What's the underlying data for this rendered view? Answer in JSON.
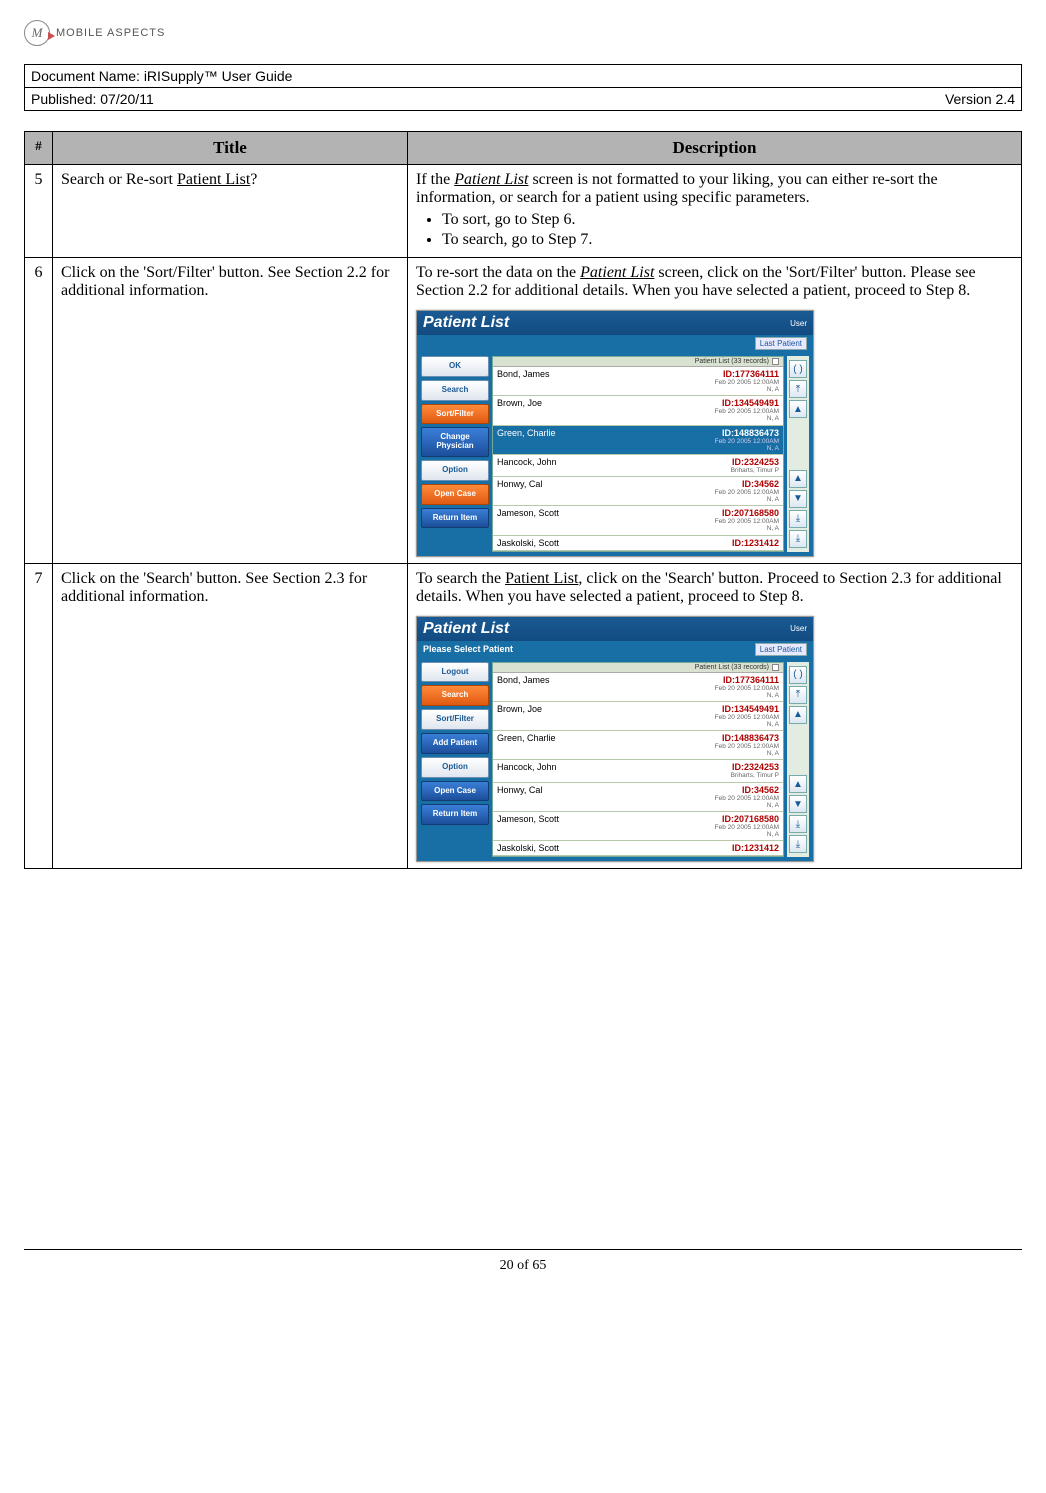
{
  "logo": {
    "text": "MOBILE ASPECTS"
  },
  "header": {
    "doc_label": "Document Name:  iRISupply™ User Guide",
    "pub_label": "Published:  07/20/11",
    "version": "Version 2.4"
  },
  "table": {
    "headers": {
      "num": "#",
      "title": "Title",
      "desc": "Description"
    },
    "rows": [
      {
        "num": "5",
        "title_pre": "Search or Re-sort ",
        "title_u": "Patient List",
        "title_post": "?",
        "desc_pre": "If the ",
        "desc_u": "Patient List",
        "desc_post": " screen is not formatted to your liking, you can either re-sort the information, or search for a patient using specific parameters.",
        "bullets": [
          "To sort, go to Step 6.",
          "To search, go to Step 7."
        ]
      },
      {
        "num": "6",
        "title": "Click on the 'Sort/Filter' button.  See Section 2.2 for additional information.",
        "desc_pre": "To re-sort the data on the ",
        "desc_u": "Patient List",
        "desc_post": " screen, click on the 'Sort/Filter' button.  Please see Section 2.2 for additional details.  When you have selected a patient, proceed to Step 8."
      },
      {
        "num": "7",
        "title": "Click on the 'Search' button.  See Section 2.3 for additional information.",
        "desc_pre": "To search the ",
        "desc_u": "Patient List",
        "desc_post": ", click on the 'Search' button.  Proceed to Section 2.3 for additional details.  When you have selected a patient, proceed to Step 8."
      }
    ]
  },
  "mini6": {
    "title": "Patient List",
    "user": "User",
    "sub": "",
    "last": "Last Patient",
    "list_header": "Patient List (33 records)",
    "sidebar": [
      {
        "label": "OK",
        "style": "default"
      },
      {
        "label": "Search",
        "style": "default"
      },
      {
        "label": "Sort/Filter",
        "style": "active-orange"
      },
      {
        "label": "Change Physician",
        "style": "active-blue"
      },
      {
        "label": "Option",
        "style": "default"
      },
      {
        "label": "Open Case",
        "style": "active-orange"
      },
      {
        "label": "Return Item",
        "style": "active-blue"
      }
    ],
    "rows": [
      {
        "name": "Bond, James",
        "id": "ID:177364111",
        "meta": "Feb 20 2005 12:00AM\nN, A"
      },
      {
        "name": "Brown, Joe",
        "id": "ID:134549491",
        "meta": "Feb 20 2005 12:00AM\nN, A"
      },
      {
        "name": "Green, Charlie",
        "id": "ID:148836473",
        "meta": "Feb 20 2005 12:00AM\nN, A",
        "sel": true
      },
      {
        "name": "Hancock, John",
        "id": "ID:2324253",
        "meta": "Briharts, Timur P"
      },
      {
        "name": "Honwy, Cal",
        "id": "ID:34562",
        "meta": "Feb 20 2005 12:00AM\nN, A"
      },
      {
        "name": "Jameson, Scott",
        "id": "ID:207168580",
        "meta": "Feb 20 2005 12:00AM\nN, A"
      },
      {
        "name": "Jaskolski, Scott",
        "id": "ID:1231412",
        "meta": ""
      }
    ]
  },
  "mini7": {
    "title": "Patient List",
    "user": "User",
    "sub": "Please Select Patient",
    "last": "Last Patient",
    "list_header": "Patient List (33 records)",
    "sidebar": [
      {
        "label": "Logout",
        "style": "default"
      },
      {
        "label": "Search",
        "style": "active-orange"
      },
      {
        "label": "Sort/Filter",
        "style": "default"
      },
      {
        "label": "Add Patient",
        "style": "active-blue"
      },
      {
        "label": "Option",
        "style": "default"
      },
      {
        "label": "Open Case",
        "style": "active-blue"
      },
      {
        "label": "Return Item",
        "style": "active-blue"
      }
    ],
    "rows": [
      {
        "name": "Bond, James",
        "id": "ID:177364111",
        "meta": "Feb 20 2005 12:00AM\nN, A"
      },
      {
        "name": "Brown, Joe",
        "id": "ID:134549491",
        "meta": "Feb 20 2005 12:00AM\nN, A"
      },
      {
        "name": "Green, Charlie",
        "id": "ID:148836473",
        "meta": "Feb 20 2005 12:00AM\nN, A"
      },
      {
        "name": "Hancock, John",
        "id": "ID:2324253",
        "meta": "Briharts, Timur P"
      },
      {
        "name": "Honwy, Cal",
        "id": "ID:34562",
        "meta": "Feb 20 2005 12:00AM\nN, A"
      },
      {
        "name": "Jameson, Scott",
        "id": "ID:207168580",
        "meta": "Feb 20 2005 12:00AM\nN, A"
      },
      {
        "name": "Jaskolski, Scott",
        "id": "ID:1231412",
        "meta": ""
      }
    ]
  },
  "scroll_glyphs": [
    "( )",
    "⤒",
    "▲",
    "▲",
    "▼",
    "⤓",
    "⤓"
  ],
  "footer": "20 of 65"
}
